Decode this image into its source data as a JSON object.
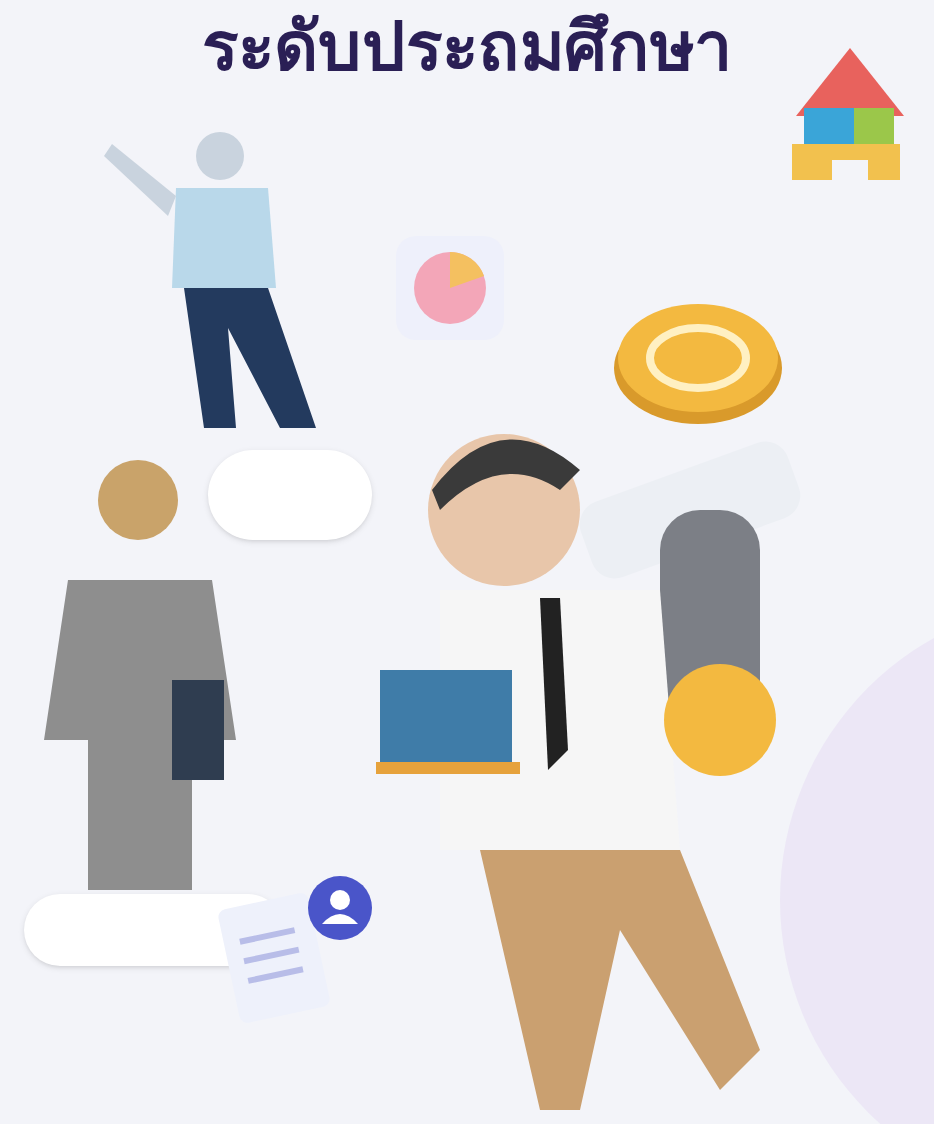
{
  "heading": {
    "text": "ระดับประถมศึกษา"
  }
}
